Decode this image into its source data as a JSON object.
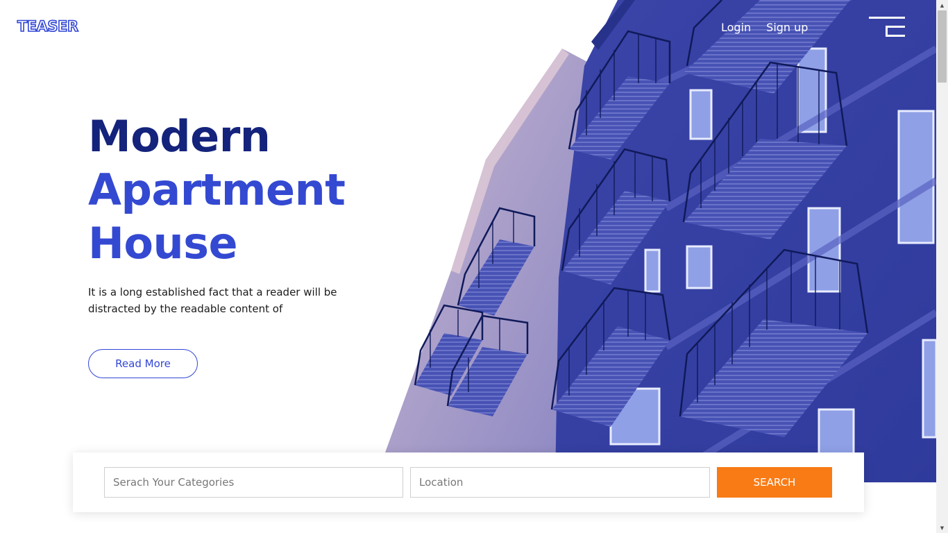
{
  "header": {
    "logo": "TEASER",
    "nav": [
      {
        "label": "Login"
      },
      {
        "label": "Sign up"
      }
    ],
    "menu_icon": "hamburger-menu-icon"
  },
  "hero": {
    "title_line1": "Modern",
    "title_line2": "Apartment",
    "title_line3": "House",
    "text": "It is a long established fact that a reader will be distracted by the readable content of",
    "button_label": "Read More",
    "image": "apartment-building-balconies-photo"
  },
  "search": {
    "categories_placeholder": "Serach Your Categories",
    "location_placeholder": "Location",
    "button_label": "SEARCH"
  },
  "colors": {
    "brand_blue": "#3246d6",
    "title_dark": "#14237b",
    "building_blue": "#3a46a6",
    "search_orange": "#f87b16"
  }
}
